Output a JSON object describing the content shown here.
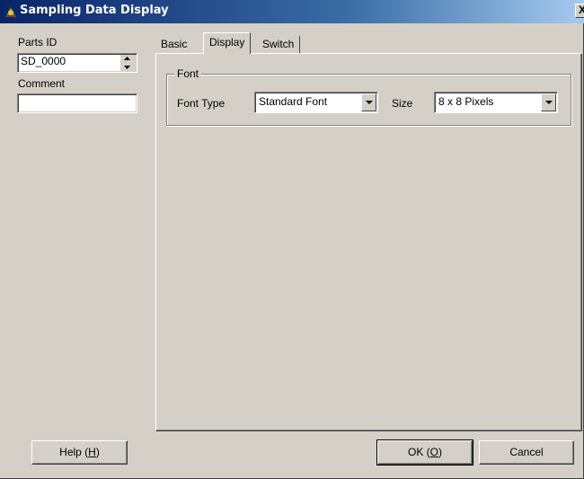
{
  "window": {
    "title": "Sampling Data Display",
    "close_label": "X"
  },
  "left": {
    "parts_id_label": "Parts ID",
    "parts_id_value": "SD_0000",
    "comment_label": "Comment",
    "comment_value": ""
  },
  "tabs": [
    {
      "label": "Basic"
    },
    {
      "label": "Display"
    },
    {
      "label": "Switch"
    }
  ],
  "font_group": {
    "caption": "Font",
    "font_type_label": "Font Type",
    "font_type_value": "Standard Font",
    "size_label": "Size",
    "size_value": "8 x 8 Pixels"
  },
  "buttons": {
    "help_text": "Help (",
    "help_key": "H",
    "ok_text": "OK (",
    "ok_key": "O",
    "close_paren": ")",
    "cancel": "Cancel"
  }
}
